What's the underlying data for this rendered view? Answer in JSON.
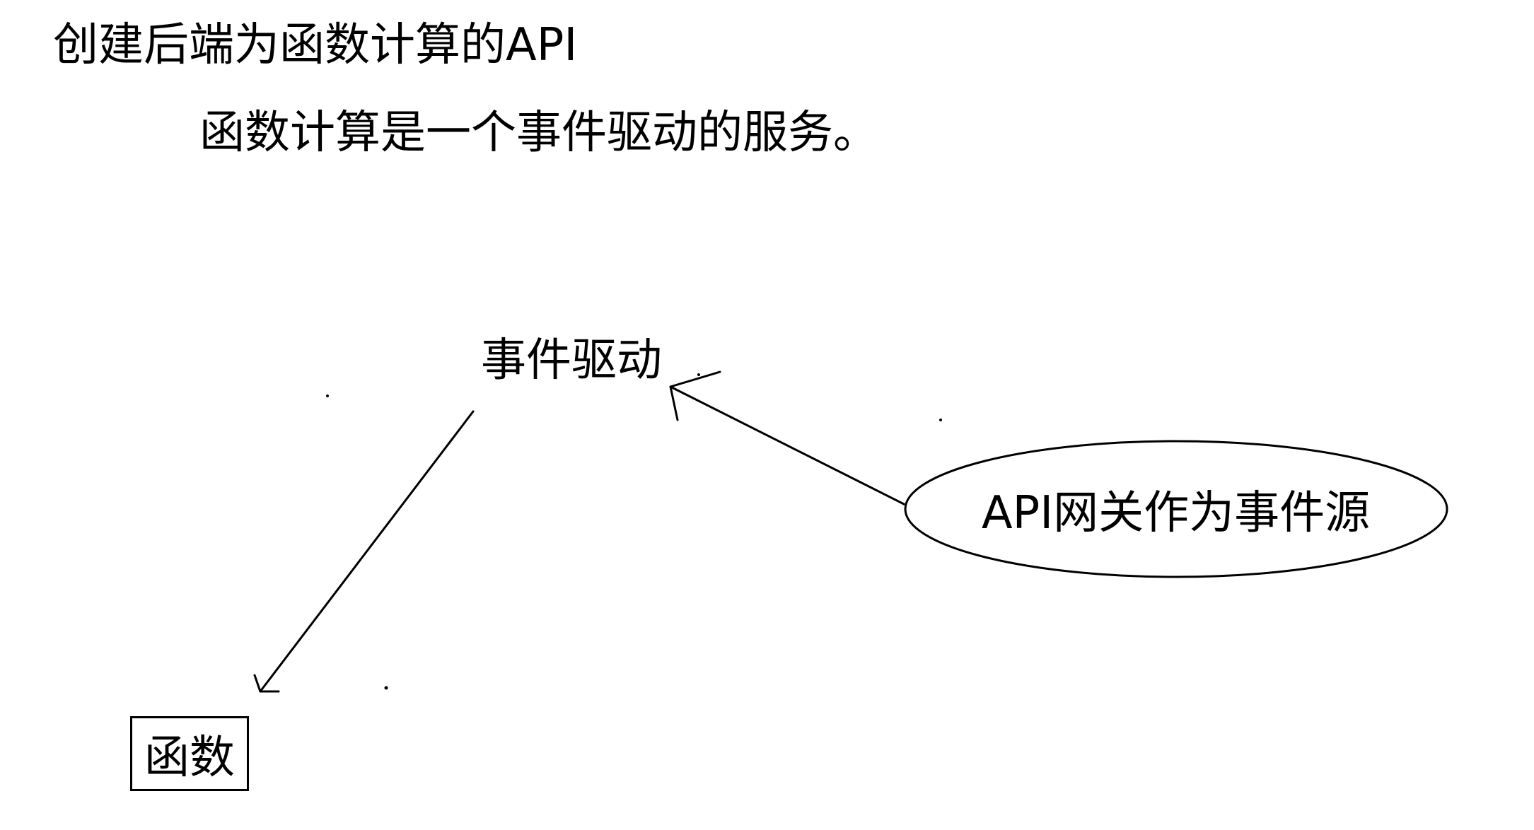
{
  "header": {
    "title": "创建后端为函数计算的API",
    "subtitle": "函数计算是一个事件驱动的服务。"
  },
  "diagram": {
    "nodes": {
      "event_driven": "事件驱动",
      "event_source": "API网关作为事件源",
      "function": "函数"
    },
    "edges": [
      {
        "from": "event_source",
        "to": "event_driven"
      },
      {
        "from": "event_driven",
        "to": "function"
      }
    ]
  }
}
